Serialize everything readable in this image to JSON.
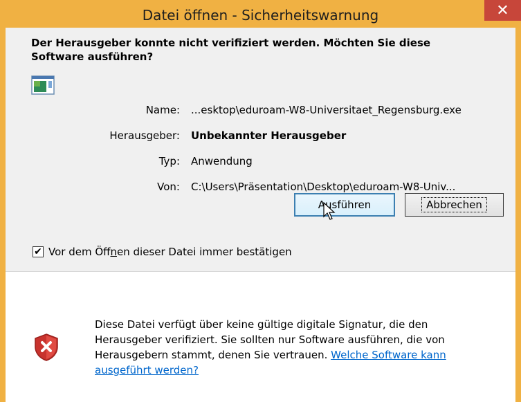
{
  "window": {
    "title": "Datei öffnen - Sicherheitswarnung",
    "close_glyph": "✕"
  },
  "heading": "Der Herausgeber konnte nicht verifiziert werden. Möchten Sie diese Software ausführen?",
  "details": {
    "name_label": "Name:",
    "name_value": "...esktop\\eduroam-W8-Universitaet_Regensburg.exe",
    "publisher_label": "Herausgeber:",
    "publisher_value": "Unbekannter Herausgeber",
    "type_label": "Typ:",
    "type_value": "Anwendung",
    "from_label": "Von:",
    "from_value": "C:\\Users\\Präsentation\\Desktop\\eduroam-W8-Univ..."
  },
  "buttons": {
    "run": "Ausführen",
    "cancel": "Abbrechen"
  },
  "checkbox": {
    "checked": true,
    "label_pre": "Vor dem Öff",
    "label_underlined": "n",
    "label_post": "en dieser Datei immer bestätigen"
  },
  "info": {
    "text": "Diese Datei verfügt über keine gültige digitale Signatur, die den Herausgeber verifiziert. Sie sollten nur Software ausführen, die von Herausgebern stammt, denen Sie vertrauen. ",
    "link": "Welche Software kann ausgeführt werden?"
  },
  "icons": {
    "app": "application-icon",
    "shield": "shield-error-icon",
    "cursor": "mouse-pointer"
  },
  "colors": {
    "titlebar": "#f0b143",
    "close": "#c7463a",
    "link": "#0066cc"
  }
}
